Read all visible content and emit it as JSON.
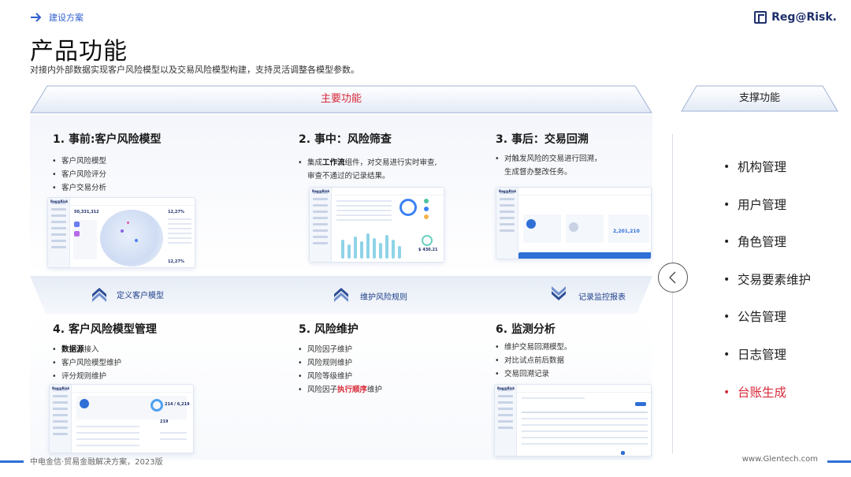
{
  "header": {
    "breadcrumb": "建设方案",
    "title": "产品功能",
    "subtitle": "对接内外部数据实现客户风险模型以及交易风险模型构建，支持灵活调整各模型参数。",
    "logo": "Reg@Risk."
  },
  "main": {
    "banner": "主要功能",
    "sections": [
      {
        "num": "1.",
        "title": "事前:客户风险模型",
        "items": [
          "客户风险模型",
          "客户风险评分",
          "客户交易分析"
        ]
      },
      {
        "num": "2.",
        "title": "事中：风险筛查",
        "items_rich": [
          {
            "pre": "集成",
            "bold": "工作流",
            "post": "组件，对交易进行实时审查,"
          },
          {
            "pre": "审查不通过的记录结果。",
            "bold": "",
            "post": ""
          }
        ]
      },
      {
        "num": "3.",
        "title": "事后：交易回溯",
        "items": [
          "对触发风险的交易进行回溯，",
          "生成督办整改任务。"
        ]
      },
      {
        "num": "4.",
        "title": "客户风险模型管理",
        "items_rich": [
          {
            "pre": "",
            "bold": "数据源",
            "post": "接入"
          }
        ],
        "items": [
          "客户风险模型维护",
          "评分规则维护"
        ]
      },
      {
        "num": "5.",
        "title": "风险维护",
        "items": [
          "风险因子维护",
          "风险规则维护",
          "风险等级维护"
        ],
        "last_rich": {
          "pre": "风险因子",
          "hl": "执行顺序",
          "post": "维护"
        }
      },
      {
        "num": "6.",
        "title": "监测分析",
        "items": [
          "维护交易回溯模型。",
          "对比试点前后数据",
          "交易回溯记录"
        ]
      }
    ],
    "band": {
      "left_label": "定义客户模型",
      "mid_label": "维护风险规则",
      "right_label": "记录监控报表"
    },
    "mock_numbers": {
      "m1a": "50,331,312",
      "m1b": "12,27%",
      "m1c": "12,27%",
      "m2": "$ 430.21",
      "m3": "2,201,210",
      "m4": "214 / 6,219",
      "m4b": "219"
    }
  },
  "side": {
    "banner": "支撑功能",
    "items": [
      "机构管理",
      "用户管理",
      "角色管理",
      "交易要素维护",
      "公告管理",
      "日志管理",
      "台账生成"
    ],
    "active_index": 6
  },
  "footer": {
    "left": "中电金信·贸易金融解决方案，2023版",
    "right": "www.Glentech.com"
  },
  "colors": {
    "accent_red": "#d92b3a",
    "accent_blue": "#2f6fd6",
    "navy": "#1d2f6b"
  }
}
